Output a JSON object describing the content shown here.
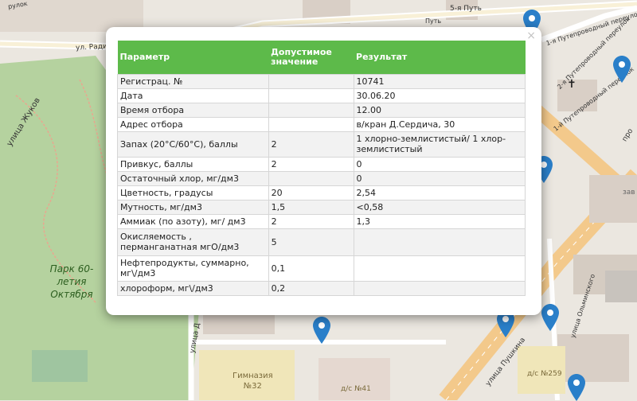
{
  "map": {
    "streets": [
      "ул. Радиатор",
      "улица Жуков",
      "1-я Путепроводный переулок",
      "2-я Путепроводный переулок",
      "1-й Путепроводный переулок",
      "улица Ольминского",
      "улица Пушкина",
      "улица Д",
      "про"
    ],
    "park_label": [
      "Парк 60-",
      "летия",
      "Октября"
    ],
    "school_label": [
      "Гимназия",
      "№32"
    ],
    "kindergarten_labels": [
      "д/с №259",
      "д/с №41"
    ],
    "other_labels": [
      "5-я Путь",
      "зав",
      "Путь",
      "рулок"
    ]
  },
  "popup": {
    "close_label": "×",
    "headers": [
      "Параметр",
      "Допустимое значение",
      "Результат"
    ],
    "rows": [
      [
        "Регистрац. №",
        "",
        "10741"
      ],
      [
        "Дата",
        "",
        "30.06.20"
      ],
      [
        "Время отбора",
        "",
        "12.00"
      ],
      [
        "Адрес отбора",
        "",
        "в/кран Д.Сердича, 30"
      ],
      [
        "Запах (20°С/60°С), баллы",
        "2",
        "1 хлорно-землистистый/ 1 хлор-землистистый"
      ],
      [
        "Привкус, баллы",
        "2",
        "0"
      ],
      [
        "Остаточный хлор, мг/дм3",
        "",
        "0"
      ],
      [
        "Цветность, градусы",
        "20",
        "2,54"
      ],
      [
        "Мутность, мг/дм3",
        "1,5",
        "<0,58"
      ],
      [
        "Аммиак (по азоту), мг/ дм3",
        "2",
        "1,3"
      ],
      [
        "Окисляемость , перманганатная мгО/дм3",
        "5",
        ""
      ],
      [
        "Нефтепродукты, суммарно, мг\\/дм3",
        "0,1",
        ""
      ],
      [
        "хлороформ, мг\\/дм3",
        "0,2",
        ""
      ]
    ]
  },
  "colors": {
    "header_green": "#5dba4a",
    "marker_blue": "#2a7fc9",
    "park_green": "#b5d29f",
    "road_orange": "#f3c98b"
  }
}
